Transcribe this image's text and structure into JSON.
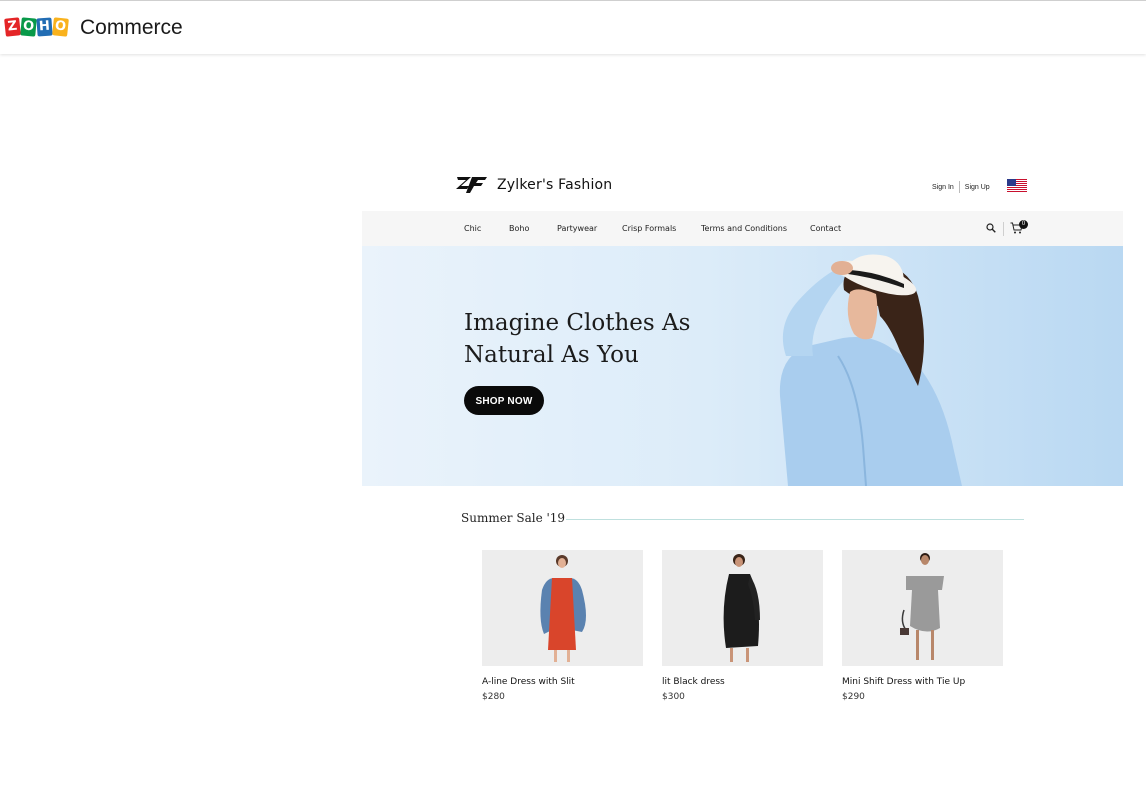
{
  "app": {
    "logo_text": "ZOHO",
    "name": "Commerce"
  },
  "store": {
    "brand_name": "Zylker's Fashion",
    "auth": {
      "sign_in": "Sign In",
      "sign_up": "Sign Up"
    },
    "nav": [
      "Chic",
      "Boho",
      "Partywear",
      "Crisp Formals",
      "Terms and Conditions",
      "Contact"
    ],
    "cart_count": "0",
    "hero": {
      "title": "Imagine Clothes As Natural As You",
      "button": "SHOP NOW"
    },
    "section_title": "Summer Sale '19",
    "products": [
      {
        "name": "A-line Dress with Slit",
        "price": "$280"
      },
      {
        "name": "lit Black dress",
        "price": "$300"
      },
      {
        "name": "Mini Shift Dress with Tie Up",
        "price": "$290"
      }
    ]
  },
  "colors": {
    "accent_line": "#bfe0de",
    "button": "#0a0a0a",
    "hero_bg": "#dcecf9"
  },
  "icons": [
    "brand-logo-icon",
    "flag-us-icon",
    "search-icon",
    "cart-icon"
  ]
}
